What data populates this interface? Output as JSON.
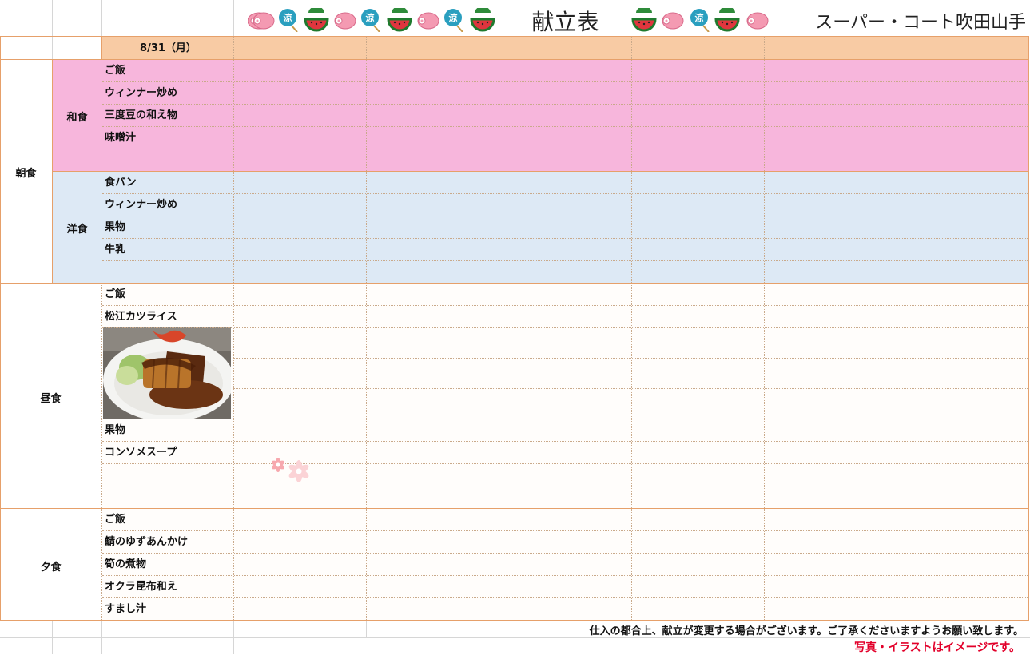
{
  "header": {
    "title": "献立表",
    "store_name": "スーパー・コート吹田山手"
  },
  "date": "8/31（月）",
  "breakfast": {
    "label": "朝食",
    "japanese": {
      "label": "和食",
      "items": [
        "ご飯",
        "ウィンナー炒め",
        "三度豆の和え物",
        "味噌汁"
      ]
    },
    "western": {
      "label": "洋食",
      "items": [
        "食パン",
        "ウィンナー炒め",
        "果物",
        "牛乳"
      ]
    }
  },
  "lunch": {
    "label": "昼食",
    "items_top": [
      "ご飯",
      "松江カツライス"
    ],
    "items_bottom": [
      "果物",
      "コンソメスープ"
    ]
  },
  "dinner": {
    "label": "夕食",
    "items": [
      "ご飯",
      "鯖のゆずあんかけ",
      "筍の煮物",
      "オクラ昆布和え",
      "すまし汁"
    ]
  },
  "notes": {
    "supply": "仕入の都合上、献立が変更する場合がございます。ご了承くださいますようお願い致します。",
    "image_notice": "写真・イラストはイメージです。"
  },
  "colors": {
    "header_band": "#f8cba4",
    "japanese_bg": "#f7b6dc",
    "western_bg": "#dde9f5",
    "border_orange": "#e6a06a",
    "notice_red": "#e2002a"
  },
  "icons": [
    "fish-cake-icon",
    "fan-cool-icon",
    "watermelon-icon"
  ]
}
